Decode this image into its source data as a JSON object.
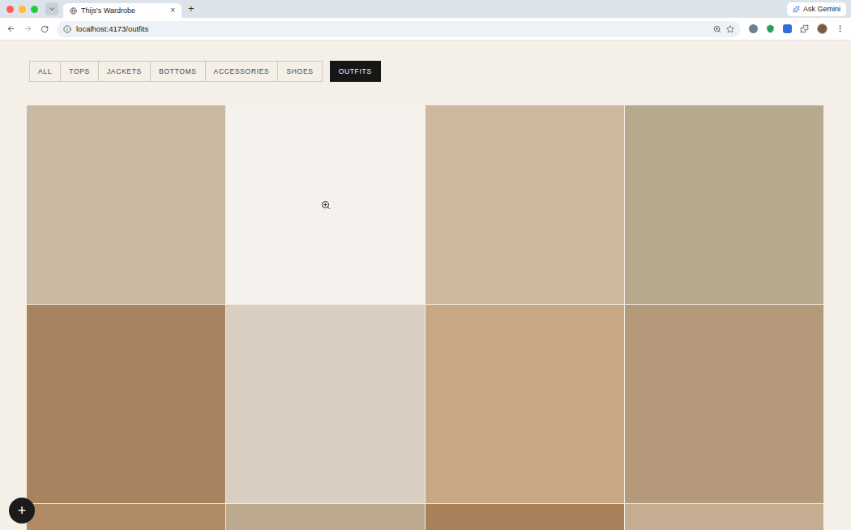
{
  "browser": {
    "tab": {
      "title": "Thijs's Wardrobe",
      "close": "×"
    },
    "new_tab": "+",
    "ask_button": "Ask Gemini",
    "url": "localhost:4173/outfits"
  },
  "filters": [
    {
      "label": "ALL",
      "selected": false
    },
    {
      "label": "TOPS",
      "selected": false
    },
    {
      "label": "JACKETS",
      "selected": false
    },
    {
      "label": "BOTTOMS",
      "selected": false
    },
    {
      "label": "ACCESSORIES",
      "selected": false
    },
    {
      "label": "SHOES",
      "selected": false
    },
    {
      "label": "OUTFITS",
      "selected": true
    }
  ],
  "outfits": [
    {
      "color": "#c9b9a3",
      "hovered": false
    },
    {
      "color": "#efe9e1",
      "hovered": true
    },
    {
      "color": "#cdb9a0",
      "hovered": false
    },
    {
      "color": "#b7a98c",
      "hovered": false
    },
    {
      "color": "#a7835f",
      "hovered": false
    },
    {
      "color": "#d8cfc2",
      "hovered": false
    },
    {
      "color": "#c8a884",
      "hovered": false
    },
    {
      "color": "#b49a7a",
      "hovered": false
    },
    {
      "color": "#b08a62",
      "hovered": false
    },
    {
      "color": "#bda98e",
      "hovered": false
    },
    {
      "color": "#a8805a",
      "hovered": false
    },
    {
      "color": "#c4ad90",
      "hovered": false
    }
  ],
  "add_button": "+"
}
